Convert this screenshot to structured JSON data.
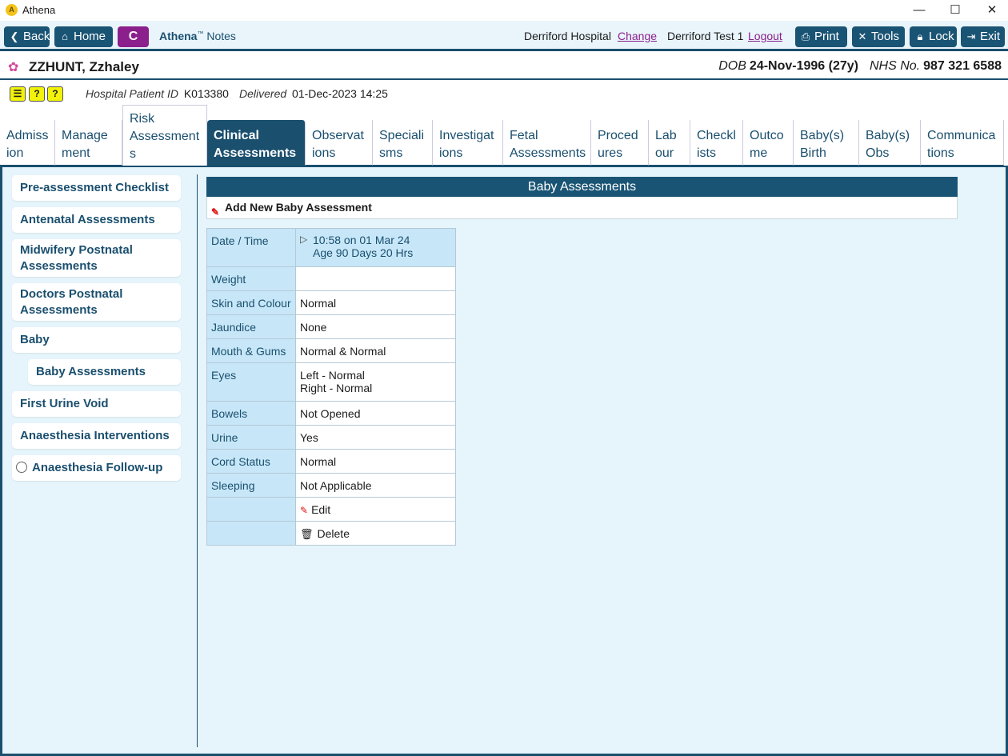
{
  "window": {
    "title": "Athena",
    "minimize": "—",
    "maximize": "☐",
    "close": "✕"
  },
  "toolbar": {
    "back": "Back",
    "home": "Home",
    "c": "C",
    "brand": "Athena",
    "brand_tm": "™",
    "brand_suffix": "Notes",
    "hospital": "Derriford Hospital",
    "change": "Change",
    "user": "Derriford Test 1",
    "logout": "Logout",
    "print": "Print",
    "tools": "Tools",
    "lock": "Lock",
    "exit": "Exit"
  },
  "patient": {
    "name": "ZZHUNT, Zzhaley",
    "dob_label": "DOB",
    "dob": "24-Nov-1996 (27y)",
    "nhs_label": "NHS No.",
    "nhs": "987 321 6588"
  },
  "info": {
    "hid_label": "Hospital Patient ID",
    "hid": "K013380",
    "delivered_label": "Delivered",
    "delivered": "01-Dec-2023 14:25"
  },
  "tabs": {
    "admission": [
      "Admiss",
      "ion"
    ],
    "management": [
      "Manage",
      "ment"
    ],
    "risk": [
      "Risk",
      "Assessment",
      "s"
    ],
    "clinical": [
      "Clinical",
      "Assessments"
    ],
    "observations": [
      "Observat",
      "ions"
    ],
    "specialisms": [
      "Speciali",
      "sms"
    ],
    "investigations": [
      "Investigat",
      "ions"
    ],
    "fetal": [
      "Fetal",
      "Assessments"
    ],
    "procedures": [
      "Proced",
      "ures"
    ],
    "labour": [
      "Lab",
      "our"
    ],
    "checklists": [
      "Checkl",
      "ists"
    ],
    "outcome": [
      "Outco",
      "me"
    ],
    "babybirth": [
      "Baby(s)",
      "Birth"
    ],
    "babyobs": [
      "Baby(s)",
      "Obs"
    ],
    "communications": [
      "Communica",
      "tions"
    ]
  },
  "sidebar": {
    "preassessment": "Pre-assessment Checklist",
    "antenatal": "Antenatal Assessments",
    "midwifery": [
      "Midwifery Postnatal",
      "Assessments"
    ],
    "doctors": [
      "Doctors Postnatal",
      "Assessments"
    ],
    "baby": "Baby",
    "babyassessments": "Baby Assessments",
    "urine": "First Urine Void",
    "anaesthesia": "Anaesthesia Interventions",
    "followup": "Anaesthesia Follow-up"
  },
  "main": {
    "header": "Baby Assessments",
    "add": "Add New Baby Assessment",
    "rows": {
      "datetime": {
        "label": "Date / Time",
        "value1": "10:58 on 01 Mar 24",
        "value2": "Age 90 Days 20 Hrs"
      },
      "weight": {
        "label": "Weight",
        "value": ""
      },
      "skin": {
        "label": "Skin and Colour",
        "value": "Normal"
      },
      "jaundice": {
        "label": "Jaundice",
        "value": "None"
      },
      "mouth": {
        "label": "Mouth & Gums",
        "value": "Normal & Normal"
      },
      "eyes": {
        "label": "Eyes",
        "value1": "Left - Normal",
        "value2": "Right - Normal"
      },
      "bowels": {
        "label": "Bowels",
        "value": "Not Opened"
      },
      "urine": {
        "label": "Urine",
        "value": "Yes"
      },
      "cord": {
        "label": "Cord Status",
        "value": "Normal"
      },
      "sleeping": {
        "label": "Sleeping",
        "value": "Not Applicable"
      }
    },
    "edit": "Edit",
    "delete": "Delete"
  }
}
